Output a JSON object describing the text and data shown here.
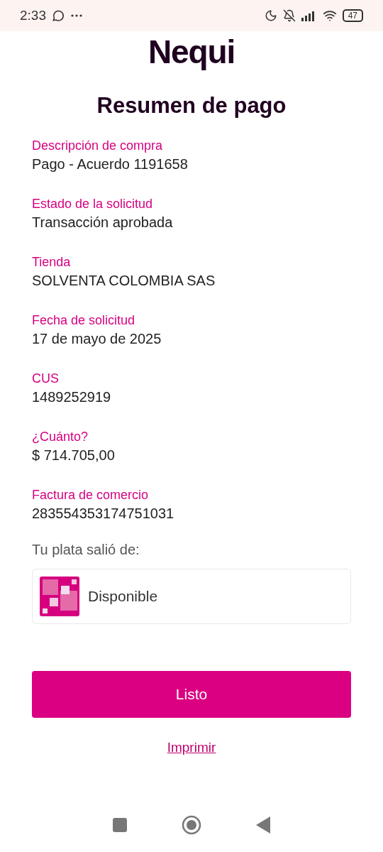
{
  "status_bar": {
    "time": "2:33",
    "battery": "47"
  },
  "logo": "Nequi",
  "title": "Resumen de pago",
  "fields": [
    {
      "label": "Descripción de compra",
      "value": "Pago - Acuerdo 1191658"
    },
    {
      "label": "Estado de la solicitud",
      "value": "Transacción aprobada"
    },
    {
      "label": "Tienda",
      "value": "SOLVENTA COLOMBIA SAS"
    },
    {
      "label": "Fecha de solicitud",
      "value": "17 de mayo de 2025"
    },
    {
      "label": "CUS",
      "value": "1489252919"
    },
    {
      "label": "¿Cuánto?",
      "value": "$ 714.705,00"
    },
    {
      "label": "Factura de comercio",
      "value": "283554353174751031"
    }
  ],
  "source": {
    "heading": "Tu plata salió de:",
    "account": "Disponible"
  },
  "primary_button": "Listo",
  "print_link": "Imprimir"
}
